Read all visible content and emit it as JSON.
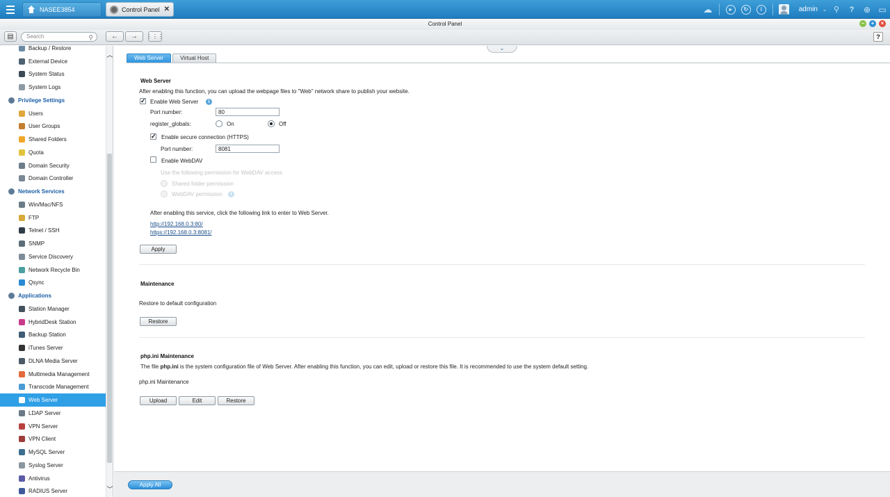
{
  "topbar": {
    "home_tab": "NASEE3854",
    "cp_tab": "Control Panel",
    "user": "admin"
  },
  "window": {
    "title": "Control Panel"
  },
  "toolbar": {
    "search_placeholder": "Search"
  },
  "sidebar": {
    "items": [
      {
        "type": "item",
        "label": "Backup / Restore",
        "icon": "backup-icon",
        "color": "#6a8aa6"
      },
      {
        "type": "item",
        "label": "External Device",
        "icon": "external-device-icon",
        "color": "#4f6272"
      },
      {
        "type": "item",
        "label": "System Status",
        "icon": "system-status-icon",
        "color": "#3b4a57"
      },
      {
        "type": "item",
        "label": "System Logs",
        "icon": "system-logs-icon",
        "color": "#8c9aa6"
      },
      {
        "type": "group",
        "label": "Privilege Settings",
        "icon": "user-icon"
      },
      {
        "type": "item",
        "label": "Users",
        "icon": "users-icon",
        "color": "#e0a73b"
      },
      {
        "type": "item",
        "label": "User Groups",
        "icon": "user-groups-icon",
        "color": "#c47d2e"
      },
      {
        "type": "item",
        "label": "Shared Folders",
        "icon": "shared-folders-icon",
        "color": "#f0a72a"
      },
      {
        "type": "item",
        "label": "Quota",
        "icon": "quota-icon",
        "color": "#e0c33b"
      },
      {
        "type": "item",
        "label": "Domain Security",
        "icon": "domain-security-icon",
        "color": "#6d7d8a"
      },
      {
        "type": "item",
        "label": "Domain Controller",
        "icon": "domain-controller-icon",
        "color": "#7a8794"
      },
      {
        "type": "group",
        "label": "Network Services",
        "icon": "network-icon"
      },
      {
        "type": "item",
        "label": "Win/Mac/NFS",
        "icon": "win-mac-nfs-icon",
        "color": "#6b7c89"
      },
      {
        "type": "item",
        "label": "FTP",
        "icon": "ftp-icon",
        "color": "#d6a93a"
      },
      {
        "type": "item",
        "label": "Telnet / SSH",
        "icon": "telnet-ssh-icon",
        "color": "#2e3c48"
      },
      {
        "type": "item",
        "label": "SNMP",
        "icon": "snmp-icon",
        "color": "#5d6e7b"
      },
      {
        "type": "item",
        "label": "Service Discovery",
        "icon": "service-discovery-icon",
        "color": "#7d8c98"
      },
      {
        "type": "item",
        "label": "Network Recycle Bin",
        "icon": "recycle-bin-icon",
        "color": "#4aa0a0"
      },
      {
        "type": "item",
        "label": "Qsync",
        "icon": "qsync-icon",
        "color": "#2a8bd4"
      },
      {
        "type": "group",
        "label": "Applications",
        "icon": "applications-icon"
      },
      {
        "type": "item",
        "label": "Station Manager",
        "icon": "station-manager-icon",
        "color": "#44525e"
      },
      {
        "type": "item",
        "label": "HybridDesk Station",
        "icon": "hybriddesk-icon",
        "color": "#c93b8c"
      },
      {
        "type": "item",
        "label": "Backup Station",
        "icon": "backup-station-icon",
        "color": "#3f5b75"
      },
      {
        "type": "item",
        "label": "iTunes Server",
        "icon": "itunes-icon",
        "color": "#333333"
      },
      {
        "type": "item",
        "label": "DLNA Media Server",
        "icon": "dlna-icon",
        "color": "#4b5a66"
      },
      {
        "type": "item",
        "label": "Multimedia Management",
        "icon": "multimedia-icon",
        "color": "#e36a3a"
      },
      {
        "type": "item",
        "label": "Transcode Management",
        "icon": "transcode-icon",
        "color": "#4a9bd6"
      },
      {
        "type": "item",
        "label": "Web Server",
        "icon": "web-server-icon",
        "color": "#ffffff",
        "active": true
      },
      {
        "type": "item",
        "label": "LDAP Server",
        "icon": "ldap-icon",
        "color": "#6b7a86"
      },
      {
        "type": "item",
        "label": "VPN Server",
        "icon": "vpn-server-icon",
        "color": "#b84040"
      },
      {
        "type": "item",
        "label": "VPN Client",
        "icon": "vpn-client-icon",
        "color": "#9e3b3b"
      },
      {
        "type": "item",
        "label": "MySQL Server",
        "icon": "mysql-icon",
        "color": "#3d6e8f"
      },
      {
        "type": "item",
        "label": "Syslog Server",
        "icon": "syslog-icon",
        "color": "#8a96a0"
      },
      {
        "type": "item",
        "label": "Antivirus",
        "icon": "antivirus-icon",
        "color": "#5a5aa8"
      },
      {
        "type": "item",
        "label": "RADIUS Server",
        "icon": "radius-icon",
        "color": "#3e5a9a"
      }
    ]
  },
  "tabs": [
    "Web Server",
    "Virtual Host"
  ],
  "web_server": {
    "title": "Web Server",
    "description": "After enabling this function, you can upload the webpage files to \"Web\" network share to publish your website.",
    "enable_label": "Enable Web Server",
    "port_label": "Port number:",
    "port_value": "80",
    "register_globals_label": "register_globals:",
    "on_label": "On",
    "off_label": "Off",
    "https_label": "Enable secure connection (HTTPS)",
    "https_port_label": "Port number:",
    "https_port_value": "8081",
    "webdav_label": "Enable WebDAV",
    "webdav_perm_label": "Use the following permission for WebDAV access",
    "shared_perm_label": "Shared folder permission",
    "webdav_perm_option": "WebDAV permission",
    "link_note": "After enabling this service, click the following link to enter to Web Server.",
    "http_link": "http://192.168.0.3:80/",
    "https_link": "https://192.168.0.3:8081/",
    "apply_label": "Apply"
  },
  "maintenance": {
    "title": "Maintenance",
    "text": "Restore to default configuration",
    "restore_label": "Restore"
  },
  "phpini": {
    "title": "php.ini Maintenance",
    "desc_prefix": "The file ",
    "desc_bold": "php.ini",
    "desc_suffix": " is the system configuration file of Web Server. After enabling this function, you can edit, upload or restore this file. It is recommended to use the system default setting.",
    "label": "php.ini Maintenance",
    "upload_label": "Upload",
    "edit_label": "Edit",
    "restore_label": "Restore"
  },
  "footer": {
    "apply_all_label": "Apply All"
  }
}
